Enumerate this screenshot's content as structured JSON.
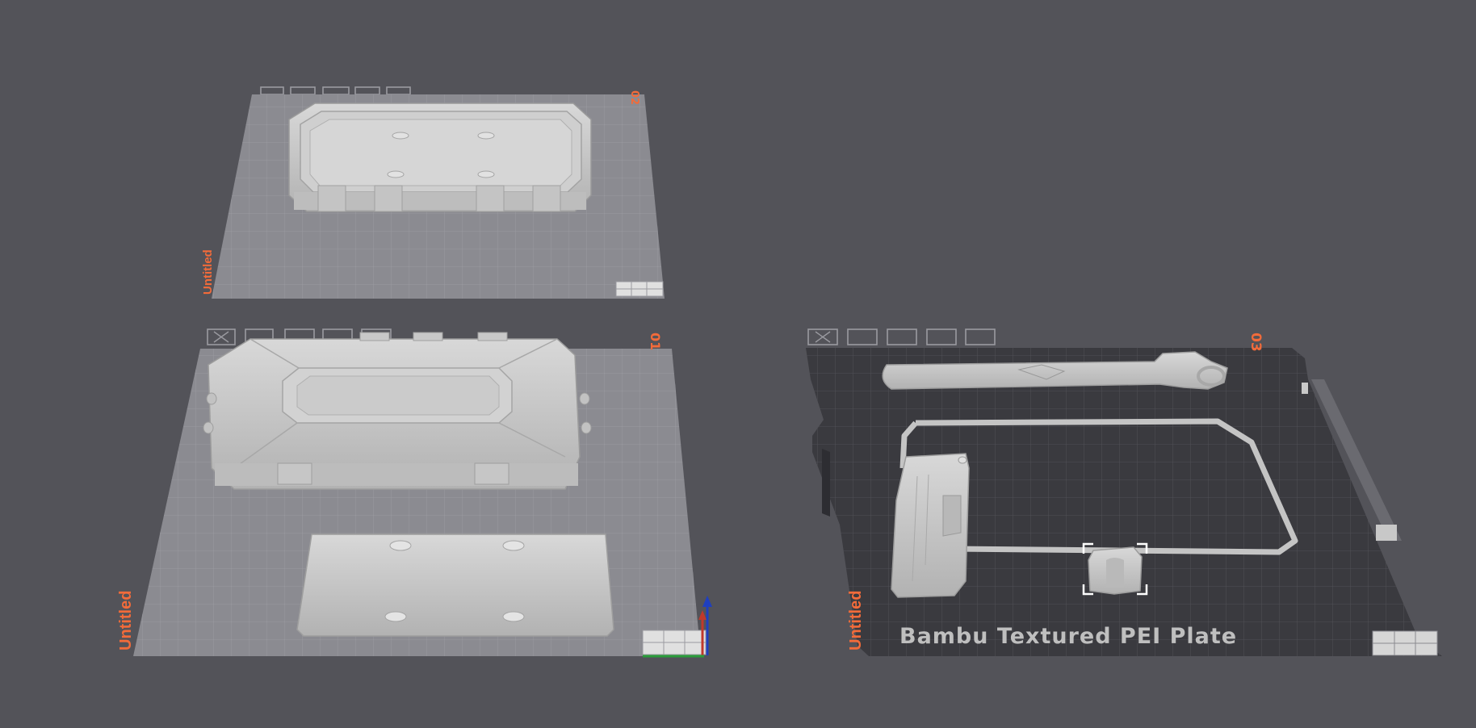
{
  "window": {
    "title": ""
  },
  "colors": {
    "background": "#535359",
    "plate_light": "#8b8b91",
    "plate_dark": "#3a3a3f",
    "accent_label": "#f26b3a",
    "model": "#c9c9c9"
  },
  "plates": [
    {
      "id": "plate-2",
      "number": "02",
      "name": "Untitled",
      "style": "light",
      "toolbar_icons": [
        "arrange-icon",
        "orient-icon",
        "lock-icon",
        "settings-icon",
        "view-icon"
      ]
    },
    {
      "id": "plate-1",
      "number": "01",
      "name": "Untitled",
      "style": "light",
      "toolbar_icons": [
        "delete-icon",
        "orient-icon",
        "arrange-icon",
        "lock-icon",
        "settings-icon"
      ]
    },
    {
      "id": "plate-3",
      "number": "03",
      "name": "Untitled",
      "style": "dark",
      "plate_type": "Bambu Textured PEI Plate",
      "toolbar_icons": [
        "delete-icon",
        "orient-icon",
        "arrange-icon",
        "lock-icon",
        "settings-icon"
      ]
    }
  ],
  "axes": {
    "x_color": "#2a9d3a",
    "y_color": "#c0392b",
    "z_color": "#1f3fbf"
  }
}
